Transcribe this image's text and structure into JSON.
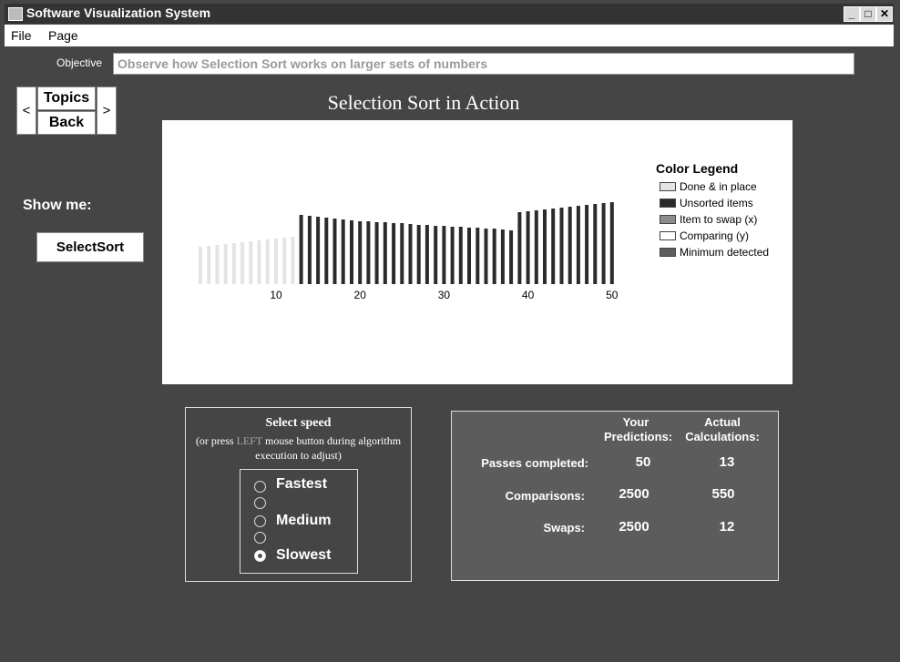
{
  "window": {
    "title": "Software Visualization System",
    "minimize": "_",
    "maximize": "□",
    "close": "✕"
  },
  "menu": {
    "file": "File",
    "page": "Page"
  },
  "objective": {
    "label": "Objective",
    "text": "Observe how Selection Sort works on larger sets of numbers"
  },
  "nav": {
    "prev": "<",
    "topics": "Topics",
    "back": "Back",
    "next": ">"
  },
  "page_title": "Selection Sort in Action",
  "show_me": {
    "label": "Show me:",
    "button": "SelectSort"
  },
  "chart_data": {
    "type": "bar",
    "categories": [
      1,
      2,
      3,
      4,
      5,
      6,
      7,
      8,
      9,
      10,
      11,
      12,
      13,
      14,
      15,
      16,
      17,
      18,
      19,
      20,
      21,
      22,
      23,
      24,
      25,
      26,
      27,
      28,
      29,
      30,
      31,
      32,
      33,
      34,
      35,
      36,
      37,
      38,
      39,
      40,
      41,
      42,
      43,
      44,
      45,
      46,
      47,
      48,
      49,
      50
    ],
    "x_ticks": [
      "10",
      "20",
      "30",
      "40",
      "50"
    ],
    "values": [
      41,
      42,
      43,
      44,
      45,
      46,
      47,
      48,
      49,
      50,
      51,
      52,
      76,
      75,
      74,
      73,
      72,
      71,
      70,
      69,
      69,
      68,
      68,
      67,
      67,
      66,
      65,
      65,
      64,
      64,
      63,
      63,
      62,
      62,
      61,
      61,
      60,
      59,
      79,
      80,
      81,
      82,
      83,
      84,
      85,
      86,
      87,
      88,
      89,
      90
    ],
    "states": [
      "done",
      "done",
      "done",
      "done",
      "done",
      "done",
      "done",
      "done",
      "done",
      "done",
      "done",
      "done",
      "unsorted",
      "unsorted",
      "unsorted",
      "unsorted",
      "unsorted",
      "unsorted",
      "unsorted",
      "unsorted",
      "unsorted",
      "unsorted",
      "unsorted",
      "unsorted",
      "unsorted",
      "unsorted",
      "unsorted",
      "unsorted",
      "unsorted",
      "unsorted",
      "unsorted",
      "unsorted",
      "unsorted",
      "unsorted",
      "unsorted",
      "unsorted",
      "unsorted",
      "unsorted",
      "unsorted",
      "unsorted",
      "unsorted",
      "unsorted",
      "unsorted",
      "unsorted",
      "unsorted",
      "unsorted",
      "unsorted",
      "unsorted",
      "unsorted",
      "unsorted"
    ],
    "ylim": [
      0,
      100
    ],
    "grid": false,
    "legend": {
      "title": "Color Legend",
      "placement": "right",
      "items": [
        {
          "label": "Done & in place",
          "color": "#e4e4e4"
        },
        {
          "label": "Unsorted items",
          "color": "#2b2b2b"
        },
        {
          "label": "Item to swap (x)",
          "color": "#8c8c8c"
        },
        {
          "label": "Comparing (y)",
          "color": "#ffffff"
        },
        {
          "label": "Minimum detected",
          "color": "#5e5e5e"
        }
      ]
    }
  },
  "speed": {
    "title": "Select speed",
    "hint_pre": "(or press ",
    "hint_key": "LEFT",
    "hint_post": " mouse button during algorithm execution to adjust)",
    "options": [
      {
        "label": "Fastest",
        "selected": false
      },
      {
        "label": "",
        "selected": false
      },
      {
        "label": "Medium",
        "selected": false
      },
      {
        "label": "",
        "selected": false
      },
      {
        "label": "Slowest",
        "selected": true
      }
    ]
  },
  "stats": {
    "col_predictions": "Your Predictions:",
    "col_actual": "Actual Calculations:",
    "rows": [
      {
        "label": "Passes completed:",
        "prediction": "50",
        "actual": "13"
      },
      {
        "label": "Comparisons:",
        "prediction": "2500",
        "actual": "550"
      },
      {
        "label": "Swaps:",
        "prediction": "2500",
        "actual": "12"
      }
    ]
  },
  "colors": {
    "background": "#454545",
    "panel": "#ffffff",
    "stats_panel": "#5c5c5c"
  }
}
